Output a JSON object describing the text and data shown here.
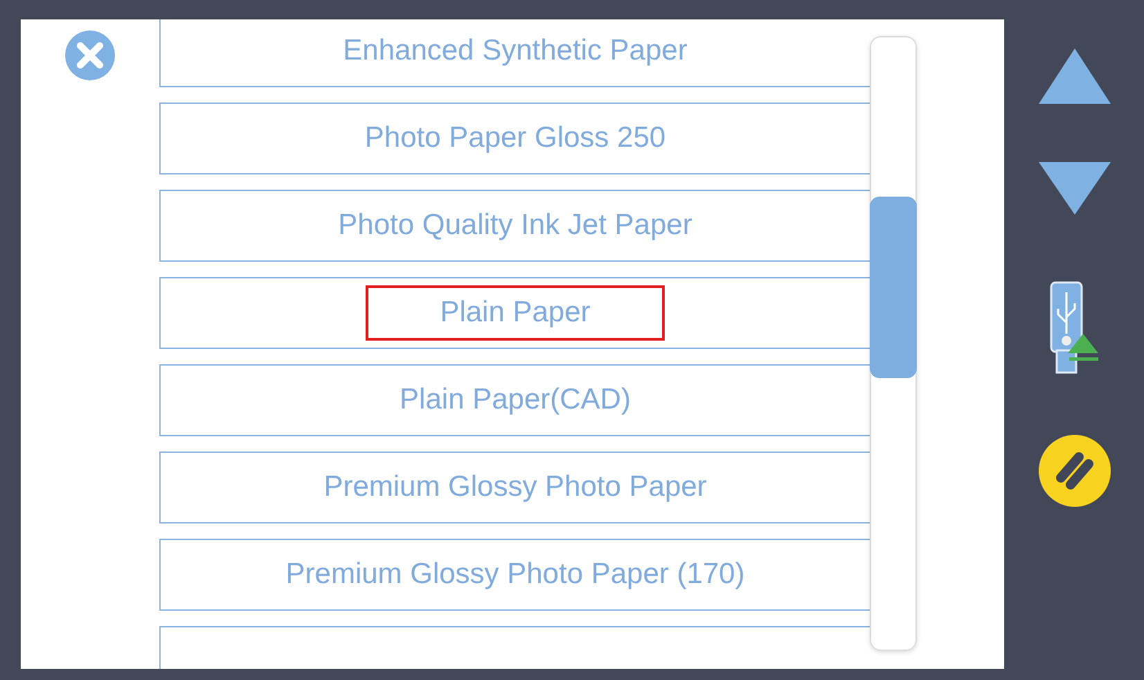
{
  "paper_list": {
    "items": [
      {
        "label": "Enhanced Synthetic Paper",
        "selected": false
      },
      {
        "label": "Photo Paper Gloss 250",
        "selected": false
      },
      {
        "label": "Photo Quality Ink Jet Paper",
        "selected": false
      },
      {
        "label": "Plain Paper",
        "selected": true
      },
      {
        "label": "Plain Paper(CAD)",
        "selected": false
      },
      {
        "label": "Premium Glossy Photo Paper",
        "selected": false
      },
      {
        "label": "Premium Glossy Photo Paper (170)",
        "selected": false
      }
    ]
  }
}
